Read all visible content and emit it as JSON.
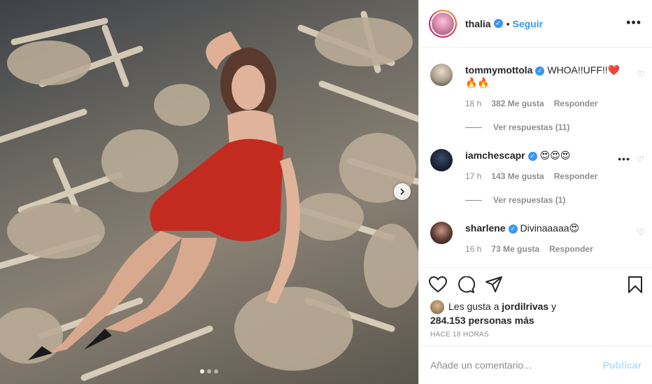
{
  "post": {
    "author": "thalia",
    "follow_label": "Seguir",
    "separator": "•",
    "more_label": "•••"
  },
  "comments": [
    {
      "user": "tommymottola",
      "text": "WHOA!!UFF!!❤️🔥🔥",
      "time": "18 h",
      "likes": "382 Me gusta",
      "reply_label": "Responder",
      "view_replies": "Ver respuestas (11)",
      "avatar_color": "#c9c2b8"
    },
    {
      "user": "iamchescapr",
      "text": "😍😍😍",
      "time": "17 h",
      "likes": "143 Me gusta",
      "reply_label": "Responder",
      "view_replies": "Ver respuestas (1)",
      "avatar_color": "#1f2a3a"
    },
    {
      "user": "sharlene",
      "text": "Divinaaaaa😍",
      "time": "16 h",
      "likes": "73 Me gusta",
      "reply_label": "Responder",
      "avatar_color": "#2b2120"
    }
  ],
  "likes": {
    "prefix": "Les gusta a",
    "user": "jordilrivas",
    "conjunction": "y",
    "count_text": "284.153 personas más"
  },
  "time_ago": "HACE 18 HORAS",
  "add_comment": {
    "placeholder": "Añade un comentario...",
    "publish_label": "Publicar"
  },
  "carousel": {
    "total": 3,
    "active": 0
  },
  "icons": [
    "heart-icon",
    "comment-icon",
    "share-icon",
    "bookmark-icon",
    "chevron-right-icon",
    "verified-icon",
    "more-icon"
  ],
  "colors": {
    "accent": "#3897f0",
    "muted": "#8e8e8e",
    "publish_disabled": "#b2dffc",
    "like_red": "#ed4956"
  }
}
